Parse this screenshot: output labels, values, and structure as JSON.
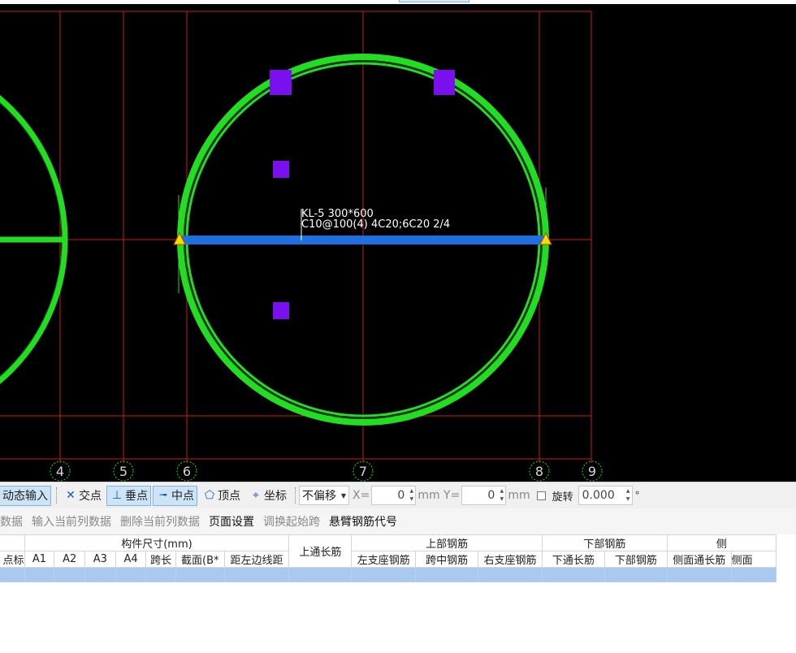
{
  "drawing": {
    "colors": {
      "background": "#000000",
      "grid_line": "#c81e1e",
      "wall": "#22dd22",
      "beam": "#1f6fe0",
      "column": "#7a10ee",
      "support": "#f0e000",
      "axis_label": "#d6d6d6"
    },
    "axis_labels": [
      "4",
      "5",
      "6",
      "7",
      "8",
      "9"
    ],
    "beam_label": {
      "line1": "KL-5 300*600",
      "line2": "C10@100(4) 4C20;6C20 2/4"
    }
  },
  "snap_toolbar": {
    "dynamic_input": "动态输入",
    "intersection": {
      "icon": "intersection-icon",
      "label": "交点"
    },
    "perpendicular": {
      "icon": "perpendicular-icon",
      "label": "垂点"
    },
    "midpoint": {
      "icon": "midpoint-icon",
      "label": "中点"
    },
    "vertex": {
      "icon": "vertex-icon",
      "label": "顶点"
    },
    "coordinate": {
      "icon": "coordinate-icon",
      "label": "坐标"
    },
    "offset_select": "不偏移",
    "x_label": "X=",
    "x_value": "0",
    "y_label": "mm Y=",
    "y_value": "0",
    "y_unit": "mm",
    "rotate_label": "旋转",
    "rotate_value": "0.000",
    "degree": "°"
  },
  "menu": [
    "跨数据",
    "输入当前列数据",
    "删除当前列数据",
    "页面设置",
    "调换起始跨",
    "悬臂钢筋代号"
  ],
  "table": {
    "group_headers": {
      "dimensions": "构件尺寸(mm)",
      "top_long": "上通长筋",
      "top_rebar": "上部钢筋",
      "bottom_rebar": "下部钢筋",
      "side": "侧"
    },
    "columns": [
      "点标",
      "A1",
      "A2",
      "A3",
      "A4",
      "跨长",
      "截面(B*",
      "距左边线距",
      "左支座钢筋",
      "跨中钢筋",
      "右支座钢筋",
      "下通长筋",
      "下部钢筋",
      "侧面通长筋",
      "侧面"
    ]
  }
}
